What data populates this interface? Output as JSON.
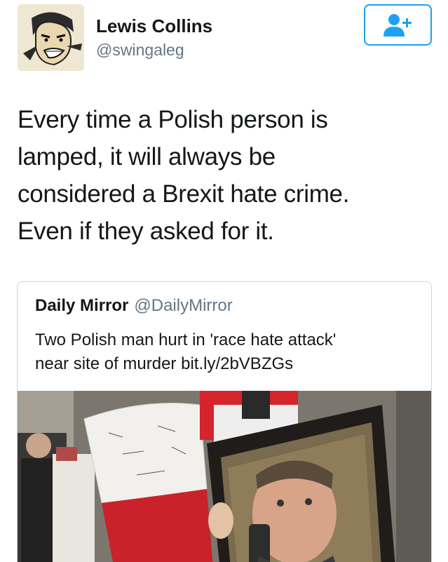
{
  "user": {
    "name": "Lewis Collins",
    "handle": "@swingaleg",
    "avatar_icon": "cartoon-face-avatar"
  },
  "follow_button": {
    "icon": "add-user-icon",
    "color": "#1da1f2"
  },
  "tweet": {
    "lines": [
      "Every time a Polish person is",
      "lamped, it will always be",
      "considered a Brexit hate crime.",
      "Even if they asked for it."
    ]
  },
  "quoted_tweet": {
    "name": "Daily Mirror",
    "handle": "@DailyMirror",
    "lines": [
      "Two Polish man hurt in 'race hate attack'",
      "near site of murder bit.ly/2bVBZGs"
    ],
    "image_description_icon": "protest-photo"
  },
  "colors": {
    "accent": "#1da1f2",
    "secondary_text": "#657786",
    "border": "#ccd6dd"
  }
}
